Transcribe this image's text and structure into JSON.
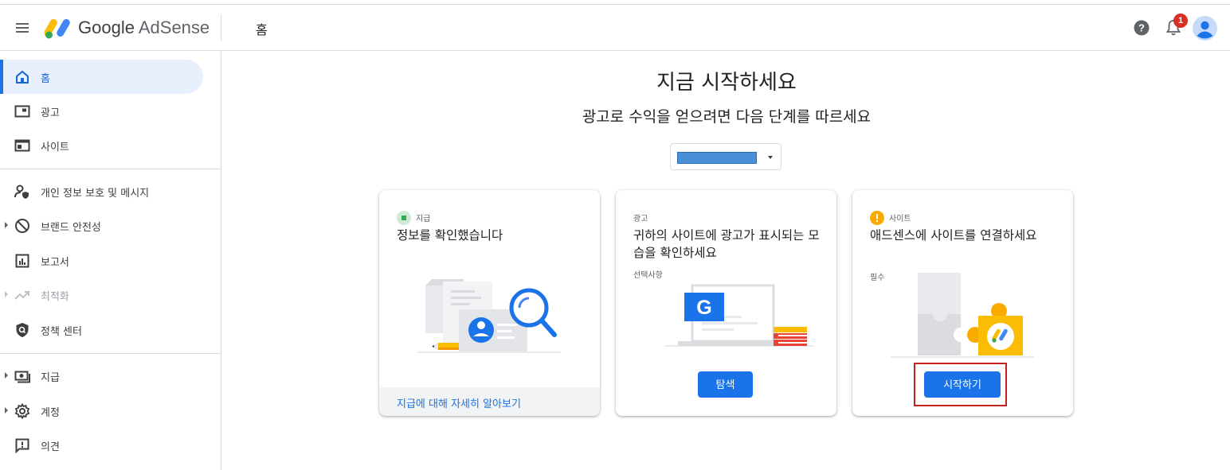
{
  "header": {
    "brand_google": "Google",
    "brand_product": "AdSense",
    "page_title": "홈",
    "notification_count": "1"
  },
  "sidebar": {
    "items": [
      {
        "label": "홈",
        "icon": "home-icon",
        "active": true
      },
      {
        "label": "광고",
        "icon": "ads-icon"
      },
      {
        "label": "사이트",
        "icon": "sites-icon"
      },
      {
        "label": "개인 정보 보호 및 메시지",
        "icon": "privacy-icon"
      },
      {
        "label": "브랜드 안전성",
        "icon": "block-icon"
      },
      {
        "label": "보고서",
        "icon": "reports-icon"
      },
      {
        "label": "최적화",
        "icon": "trending-icon",
        "disabled": true
      },
      {
        "label": "정책 센터",
        "icon": "shield-icon"
      },
      {
        "label": "지급",
        "icon": "payments-icon"
      },
      {
        "label": "계정",
        "icon": "gear-icon"
      },
      {
        "label": "의견",
        "icon": "feedback-icon"
      }
    ]
  },
  "main": {
    "title": "지금 시작하세요",
    "subtitle": "광고로 수익을 얻으려면 다음 단계를 따르세요"
  },
  "cards": [
    {
      "tag": "지급",
      "status": "done",
      "title": "정보를 확인했습니다",
      "footer_link": "지급에 대해 자세히 알아보기"
    },
    {
      "tag": "광고",
      "title": "귀하의 사이트에 광고가 표시되는 모습을 확인하세요",
      "subtitle": "선택사항",
      "button": "탐색"
    },
    {
      "tag": "사이트",
      "status": "warning",
      "title": "애드센스에 사이트를 연결하세요",
      "subtitle": "필수",
      "button": "시작하기"
    }
  ],
  "colors": {
    "accent": "#1a73e8",
    "active_bg": "#e8f0fe",
    "success": "#34a853",
    "warning": "#f9ab00",
    "highlight": "#c5221f"
  }
}
